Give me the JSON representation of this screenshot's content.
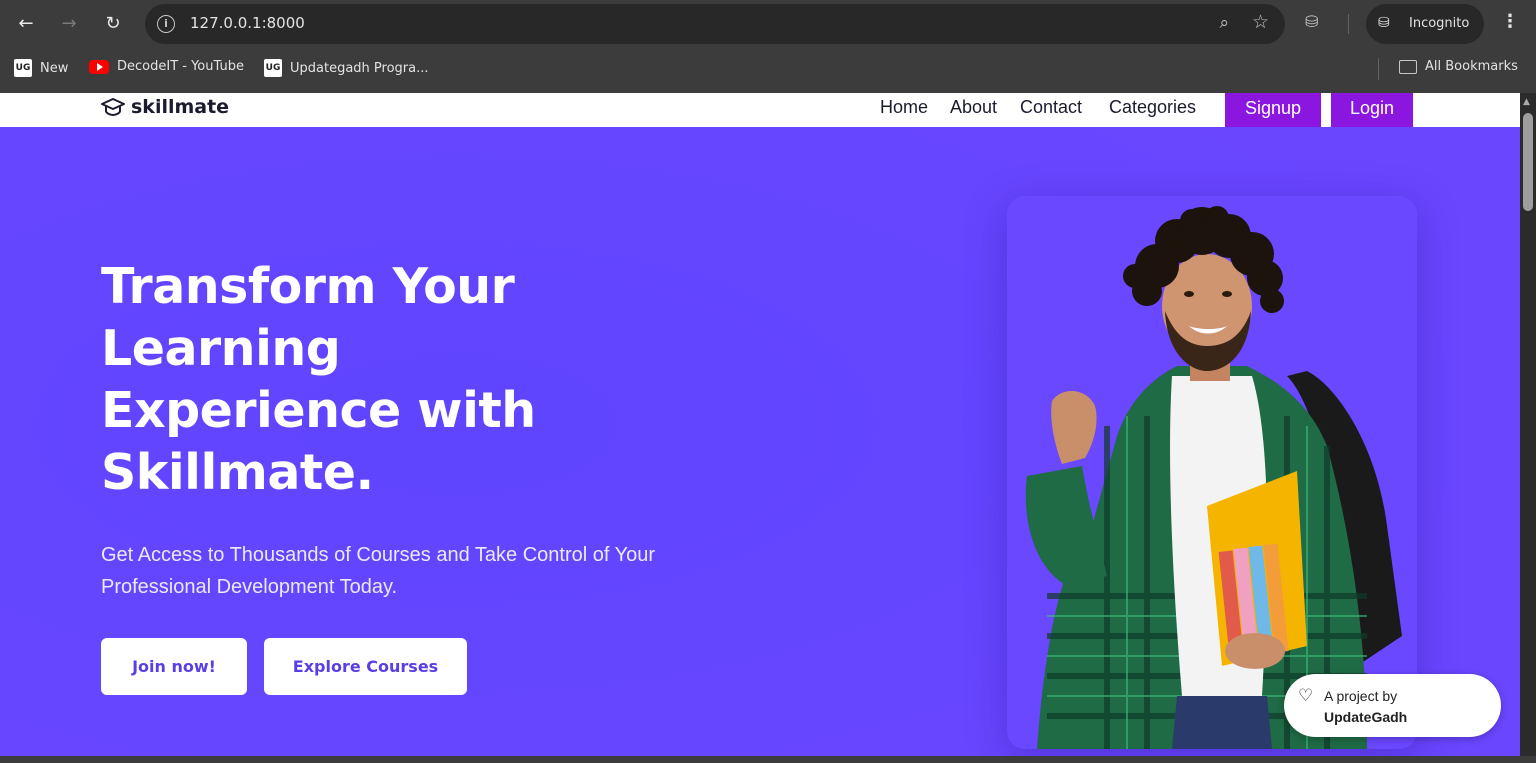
{
  "browser": {
    "url": "127.0.0.1:8000",
    "incognito_label": "Incognito",
    "bookmarks": [
      {
        "label": "New",
        "icon": "updategadh-icon"
      },
      {
        "label": "DecodeIT - YouTube",
        "icon": "youtube-icon"
      },
      {
        "label": "Updategadh Progra...",
        "icon": "updategadh-icon"
      }
    ],
    "all_bookmarks_label": "All Bookmarks"
  },
  "site": {
    "logo_text": "skillmate",
    "nav": {
      "home": "Home",
      "about": "About",
      "contact": "Contact",
      "categories": "Categories",
      "signup": "Signup",
      "login": "Login"
    },
    "hero": {
      "title": "Transform Your Learning Experience with Skillmate.",
      "subtitle": "Get Access to Thousands of Courses and Take Control of Your Professional Development Today.",
      "join_button": "Join now!",
      "explore_button": "Explore Courses"
    },
    "credit": {
      "line1": "A project by",
      "line2": "UpdateGadh"
    }
  },
  "colors": {
    "hero_bg": "#6344ff",
    "nav_button": "#8b16df",
    "button_text": "#5a3fe6"
  }
}
